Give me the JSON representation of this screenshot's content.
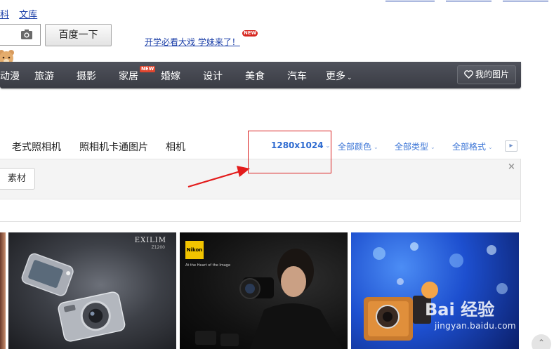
{
  "top_links": [
    "科",
    "文库"
  ],
  "search": {
    "button_label": "百度一下",
    "placeholder": ""
  },
  "promo": {
    "text": "开学必看大戏 学妹来了！",
    "badge": "NEW"
  },
  "nav": {
    "items": [
      "动漫",
      "旅游",
      "摄影",
      "家居",
      "婚嫁",
      "设计",
      "美食",
      "汽车",
      "更多"
    ],
    "new_badge": "NEW",
    "my_pictures": "我的图片"
  },
  "related_tags": [
    "老式照相机",
    "照相机卡通图片",
    "相机"
  ],
  "filters": {
    "size": "1280x1024",
    "color": "全部颜色",
    "type": "全部类型",
    "format": "全部格式"
  },
  "panel": {
    "tag_button": "素材"
  },
  "thumbs": {
    "exilim_brand": "EXILIM",
    "exilim_model": "Z1200",
    "nikon_brand": "Nikon",
    "nikon_tagline": "At the Heart of the Image"
  },
  "watermark": {
    "brand": "Bai 经验",
    "url": "jingyan.baidu.com"
  },
  "colors": {
    "nav_bg": "#45474f",
    "link_blue": "#1a3ea8",
    "filter_blue": "#3a74d6",
    "highlight_red": "#d92020"
  }
}
